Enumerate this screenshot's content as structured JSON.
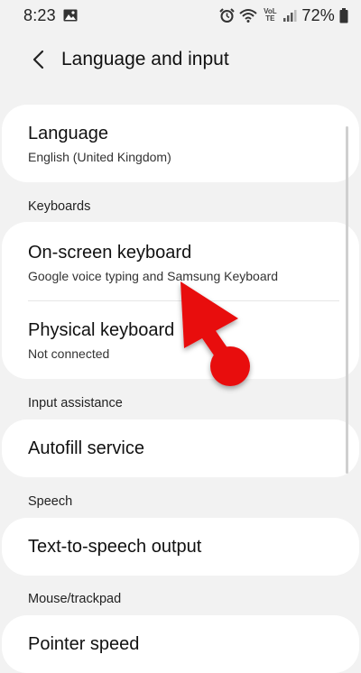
{
  "status_bar": {
    "time": "8:23",
    "volte_label": "VoLTE",
    "battery_percent": "72%"
  },
  "header": {
    "title": "Language and input"
  },
  "sections": {
    "language": {
      "title": "Language",
      "subtitle": "English (United Kingdom)"
    },
    "keyboards_label": "Keyboards",
    "on_screen": {
      "title": "On-screen keyboard",
      "subtitle": "Google voice typing and Samsung Keyboard"
    },
    "physical": {
      "title": "Physical keyboard",
      "subtitle": "Not connected"
    },
    "input_assistance_label": "Input assistance",
    "autofill": {
      "title": "Autofill service"
    },
    "speech_label": "Speech",
    "tts": {
      "title": "Text-to-speech output"
    },
    "mouse_label": "Mouse/trackpad",
    "pointer": {
      "title": "Pointer speed"
    }
  },
  "icons": {
    "image": "image-icon",
    "alarm": "alarm-icon",
    "wifi": "wifi-icon",
    "signal": "signal-icon",
    "battery": "battery-icon",
    "back": "back-arrow-icon"
  },
  "colors": {
    "background": "#f2f2f2",
    "card": "#ffffff",
    "annotation_arrow": "#e8090c"
  }
}
